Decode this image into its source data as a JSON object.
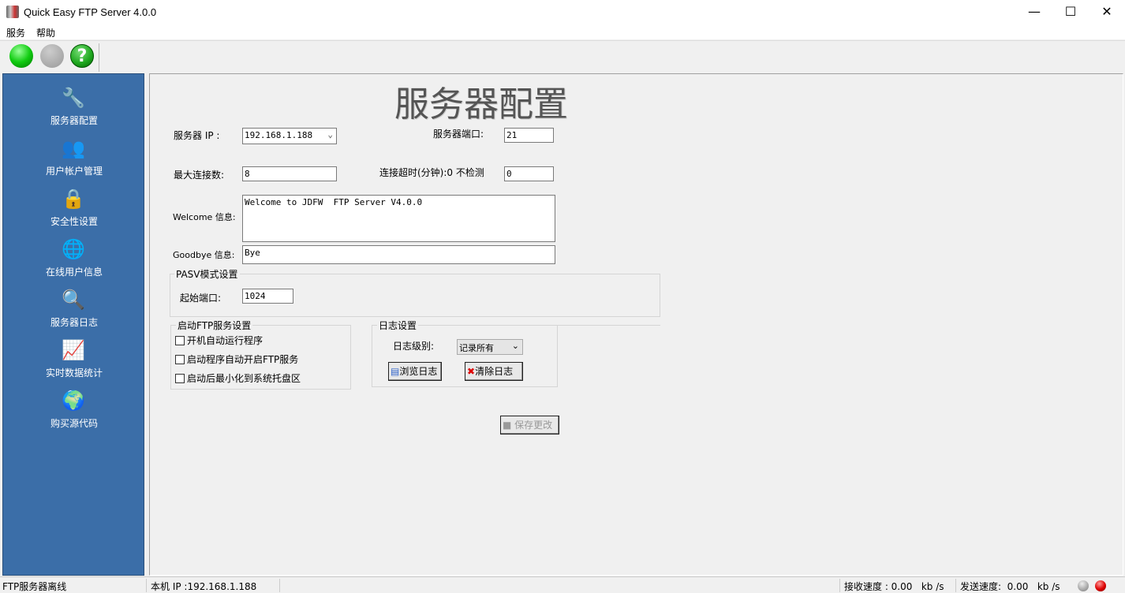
{
  "window": {
    "title": "Quick Easy FTP Server 4.0.0",
    "minimize": "—",
    "maximize": "☐",
    "close": "✕"
  },
  "menu": [
    "服务",
    "帮助"
  ],
  "toolbar": {
    "start_icon": "green-ball",
    "stop_icon": "gray-ball",
    "help_icon": "?"
  },
  "sidebar": [
    {
      "label": "服务器配置",
      "icon": "🔧"
    },
    {
      "label": "用户帐户管理",
      "icon": "👥"
    },
    {
      "label": "安全性设置",
      "icon": "🔒"
    },
    {
      "label": "在线用户信息",
      "icon": "🌐"
    },
    {
      "label": "服务器日志",
      "icon": "🔍"
    },
    {
      "label": "实时数据统计",
      "icon": "📈"
    },
    {
      "label": "购买源代码",
      "icon": "🌍"
    }
  ],
  "main": {
    "heading": "服务器配置",
    "ip_label": "服务器 IP :",
    "ip_value": "192.168.1.188",
    "port_label": "服务器端口:",
    "port_value": "21",
    "maxconn_label": "最大连接数:",
    "maxconn_value": "8",
    "timeout_label": "连接超时(分钟):0 不检测",
    "timeout_value": "0",
    "welcome_label": "Welcome 信息:",
    "welcome_value": "Welcome to JDFW  FTP Server V4.0.0",
    "goodbye_label": "Goodbye 信息:",
    "goodbye_value": "Bye",
    "pasv_title": "PASV模式设置",
    "pasv_start_label": "起始端口:",
    "pasv_start_value": "1024",
    "startup_title": "启动FTP服务设置",
    "startup_options": [
      {
        "label": "开机自动运行程序",
        "checked": false
      },
      {
        "label": "启动程序自动开启FTP服务",
        "checked": false
      },
      {
        "label": "启动后最小化到系统托盘区",
        "checked": false
      }
    ],
    "log_title": "日志设置",
    "log_level_label": "日志级别:",
    "log_level_value": "记录所有",
    "browse_log": "浏览日志",
    "clear_log": "清除日志",
    "save": "保存更改"
  },
  "status": {
    "server": "FTP服务器离线",
    "local_ip": "本机 IP :192.168.1.188",
    "recv": "接收速度 : 0.00   kb /s",
    "send": "发送速度:  0.00   kb /s"
  }
}
